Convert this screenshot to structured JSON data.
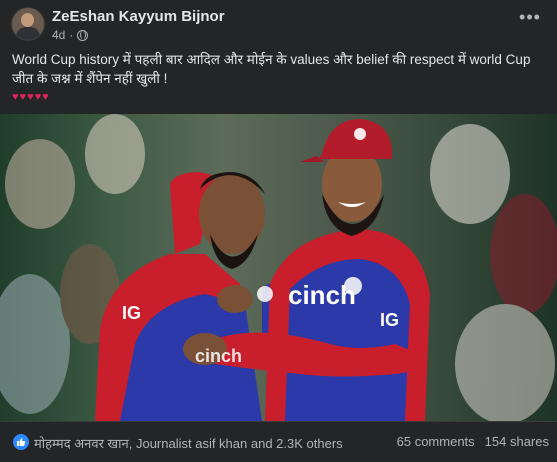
{
  "post": {
    "author": "ZeEshan Kayyum Bijnor",
    "time": "4d",
    "separator": "·",
    "visibility_icon": "globe-icon",
    "more_icon": "more-options-icon",
    "text": "World Cup history में पहली बार आदिल और मोईन के values और belief की respect में world Cup जीत के जश्न में शैंपेन नहीं खुली !",
    "emoji_line": "♥♥♥♥♥",
    "photo_caption": "",
    "photo_shirt_text": [
      "IG",
      "cinch",
      "IG",
      "cinch"
    ]
  },
  "engagement": {
    "like_icon": "like-icon",
    "reaction_text": "मोहम्मद अनवर खान, Journalist asif khan and 2.3K others",
    "comments": "65 comments",
    "shares": "154 shares"
  },
  "colors": {
    "background": "#242526",
    "text_primary": "#e4e6eb",
    "text_secondary": "#b0b3b8",
    "like_blue": "#2d88ff",
    "heart_red": "#e0245e",
    "kit_red": "#d21f2c",
    "kit_blue": "#2b3aa8"
  }
}
